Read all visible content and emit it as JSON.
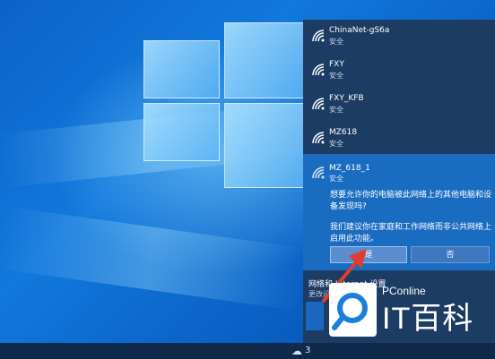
{
  "wifi_flyout": {
    "networks": [
      {
        "ssid": "ChinaNet-gS6a",
        "status": "安全"
      },
      {
        "ssid": "FXY",
        "status": "安全"
      },
      {
        "ssid": "FXY_KFB",
        "status": "安全"
      },
      {
        "ssid": "MZ618",
        "status": "安全"
      }
    ],
    "selected": {
      "ssid": "MZ_618_1",
      "status": "安全",
      "question": "想要允许你的电脑被此网络上的其他电脑和设备发现吗?",
      "advice": "我们建议你在家庭和工作网络而非公共网络上启用此功能。",
      "yes_label": "是",
      "no_label": "否"
    },
    "settings_label": "网络和 Internet 设置",
    "settings_sub": "更改设置"
  },
  "taskbar": {
    "weather_icon": "cloud-icon",
    "temperature": "3"
  },
  "watermark": {
    "brand_small": "PConline",
    "brand_big": "IT百科"
  },
  "colors": {
    "flyout_bg": "#1d3c63",
    "selected_bg": "#1a6cc0",
    "arrow": "#e23b2f"
  }
}
